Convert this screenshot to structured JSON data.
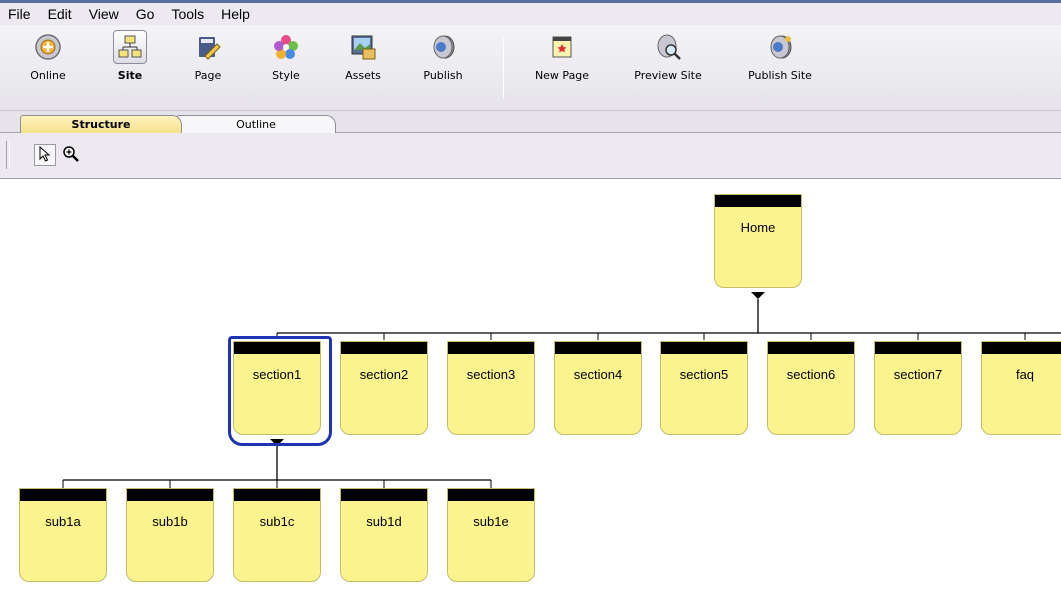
{
  "menu": [
    "File",
    "Edit",
    "View",
    "Go",
    "Tools",
    "Help"
  ],
  "toolbar": {
    "buttons": [
      {
        "label": "Online",
        "icon": "online-icon"
      },
      {
        "label": "Site",
        "icon": "site-icon",
        "active": true
      },
      {
        "label": "Page",
        "icon": "page-icon"
      },
      {
        "label": "Style",
        "icon": "style-icon"
      },
      {
        "label": "Assets",
        "icon": "assets-icon"
      },
      {
        "label": "Publish",
        "icon": "publish-icon"
      },
      {
        "label": "New Page",
        "icon": "new-page-icon"
      },
      {
        "label": "Preview Site",
        "icon": "preview-site-icon"
      },
      {
        "label": "Publish Site",
        "icon": "publish-site-icon"
      }
    ]
  },
  "tabs": [
    {
      "label": "Structure",
      "active": true
    },
    {
      "label": "Outline",
      "active": false
    }
  ],
  "tools": [
    {
      "icon": "pointer-icon",
      "active": true
    },
    {
      "icon": "zoom-in-icon",
      "active": false
    }
  ],
  "site": {
    "root": "Home",
    "sections": [
      "section1",
      "section2",
      "section3",
      "section4",
      "section5",
      "section6",
      "section7",
      "faq"
    ],
    "selected": "section1",
    "subpages": [
      "sub1a",
      "sub1b",
      "sub1c",
      "sub1d",
      "sub1e"
    ]
  },
  "colors": {
    "node_fill": "#fbf48e",
    "node_header": "#000000",
    "selection": "#1f34b5"
  }
}
